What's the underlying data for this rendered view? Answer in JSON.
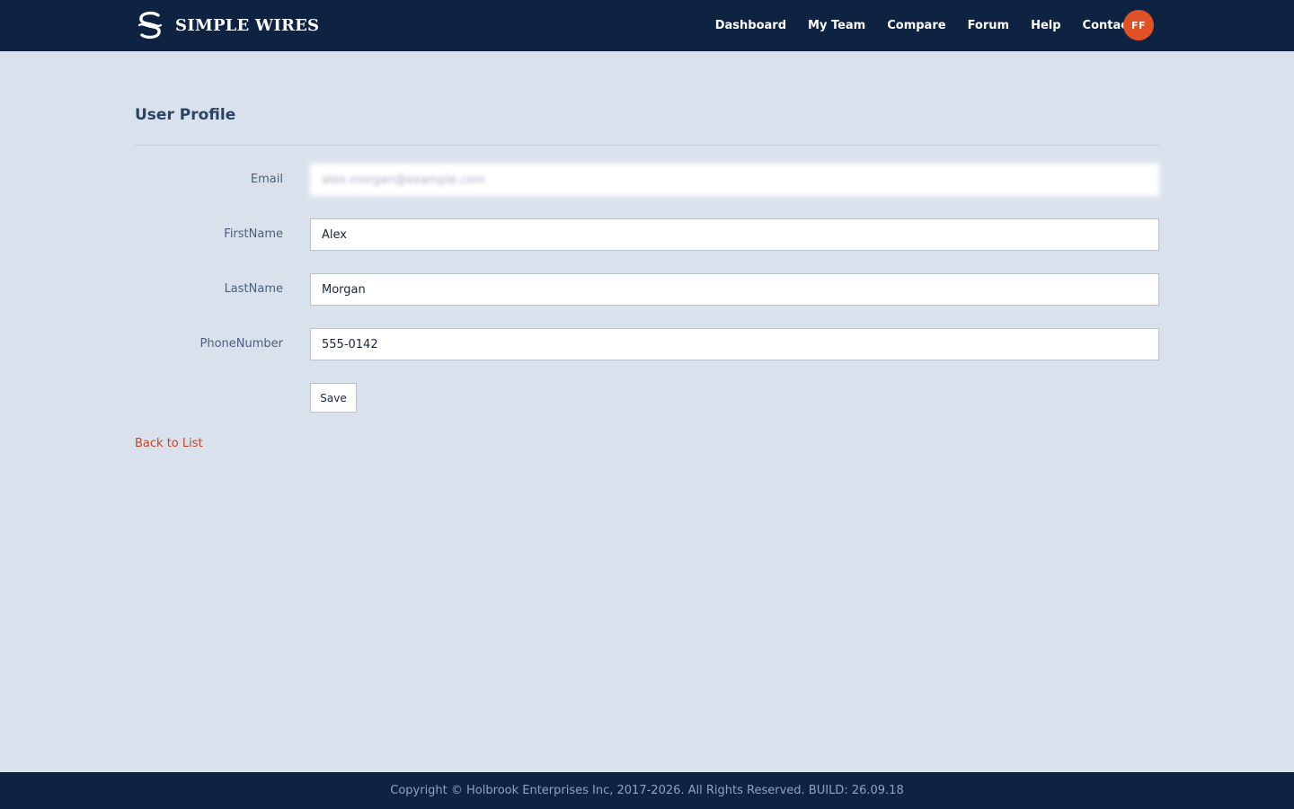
{
  "brand": {
    "name": "SIMPLE WIRES",
    "logo_icon": "simple-wires-logo-icon"
  },
  "nav": {
    "items": [
      {
        "label": "Dashboard"
      },
      {
        "label": "My Team"
      },
      {
        "label": "Compare"
      },
      {
        "label": "Forum"
      },
      {
        "label": "Help"
      },
      {
        "label": "Contact Us"
      }
    ],
    "avatar_initials": "FF"
  },
  "page": {
    "title": "User Profile"
  },
  "form": {
    "email": {
      "label": "Email",
      "value": "alex.morgan@example.com",
      "obscured": true
    },
    "first_name": {
      "label": "FirstName",
      "value": "Alex"
    },
    "last_name": {
      "label": "LastName",
      "value": "Morgan"
    },
    "phone_number": {
      "label": "PhoneNumber",
      "value": "555-0142"
    },
    "save_label": "Save"
  },
  "back_link": "Back to List",
  "footer": {
    "text": "Copyright © Holbrook Enterprises Inc, 2017-2026. All Rights Reserved. BUILD: 26.09.18"
  },
  "colors": {
    "header_bg": "#0e2242",
    "page_bg": "#d9e1ec",
    "avatar_bg": "#e05226",
    "link": "#c0472a"
  }
}
